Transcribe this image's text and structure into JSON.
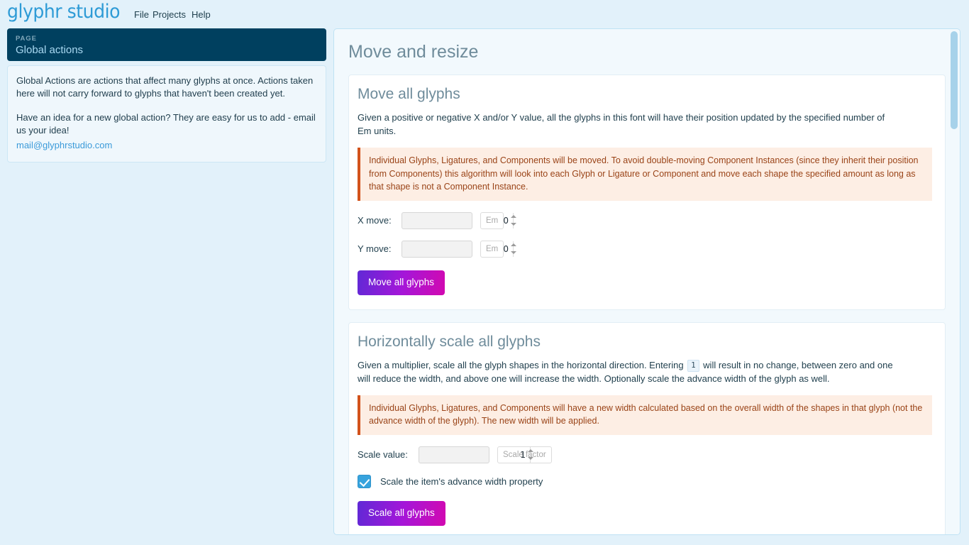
{
  "app": {
    "logo": "glyphr studio",
    "menu": [
      {
        "label": "File"
      },
      {
        "label": "Projects"
      },
      {
        "label": "Help"
      }
    ]
  },
  "sidebar": {
    "kicker": "PAGE",
    "title": "Global actions",
    "paragraph_1": "Global Actions are actions that affect many glyphs at once. Actions taken here will not carry forward to glyphs that haven't been created yet.",
    "paragraph_2": "Have an idea for a new global action? They are easy for us to add - email us your idea!",
    "email": "mail@glyphrstudio.com"
  },
  "main": {
    "title": "Move and resize",
    "cards": [
      {
        "title": "Move all glyphs",
        "description": "Given a positive or negative X and/or Y value, all the glyphs in this font will have their position updated by the specified number of Em units.",
        "notice": "Individual Glyphs, Ligatures, and Components will be moved. To avoid double-moving Component Instances (since they inherit their position from Components) this algorithm will look into each Glyph or Ligature or Component and move each shape the specified amount as long as that shape is not a Component Instance.",
        "fields": [
          {
            "label": "X move:",
            "value": "0",
            "unit": "Em"
          },
          {
            "label": "Y move:",
            "value": "0",
            "unit": "Em"
          }
        ],
        "button": "Move all glyphs"
      },
      {
        "title": "Horizontally scale all glyphs",
        "description_part_1": "Given a multiplier, scale all the glyph shapes in the horizontal direction. Entering",
        "description_code": "1",
        "description_part_2": "will result in no change, between zero and one will reduce the width, and above one will increase the width. Optionally scale the advance width of the glyph as well.",
        "notice": "Individual Glyphs, Ligatures, and Components will have a new width calculated based on the overall width of the shapes in that glyph (not the advance width of the glyph). The new width will be applied.",
        "field": {
          "label": "Scale value:",
          "value": "1",
          "unit": "Scale factor"
        },
        "checkbox_label": "Scale the item's advance width property",
        "checkbox_checked": true,
        "button": "Scale all glyphs"
      }
    ]
  },
  "colors": {
    "page_background": "#e2f1fa",
    "panel_background": "#f2f9fd",
    "page_header_background": "#00405f",
    "accent_blue": "#3a9ad9",
    "notice_background": "#fdeee4",
    "notice_border": "#d2521b",
    "notice_text": "#9a4418",
    "button_gradient_start": "#6029d6",
    "button_gradient_end": "#d209b0",
    "checkbox_checked": "#37a3dd",
    "scrollbar_thumb": "#a7d2ea"
  }
}
